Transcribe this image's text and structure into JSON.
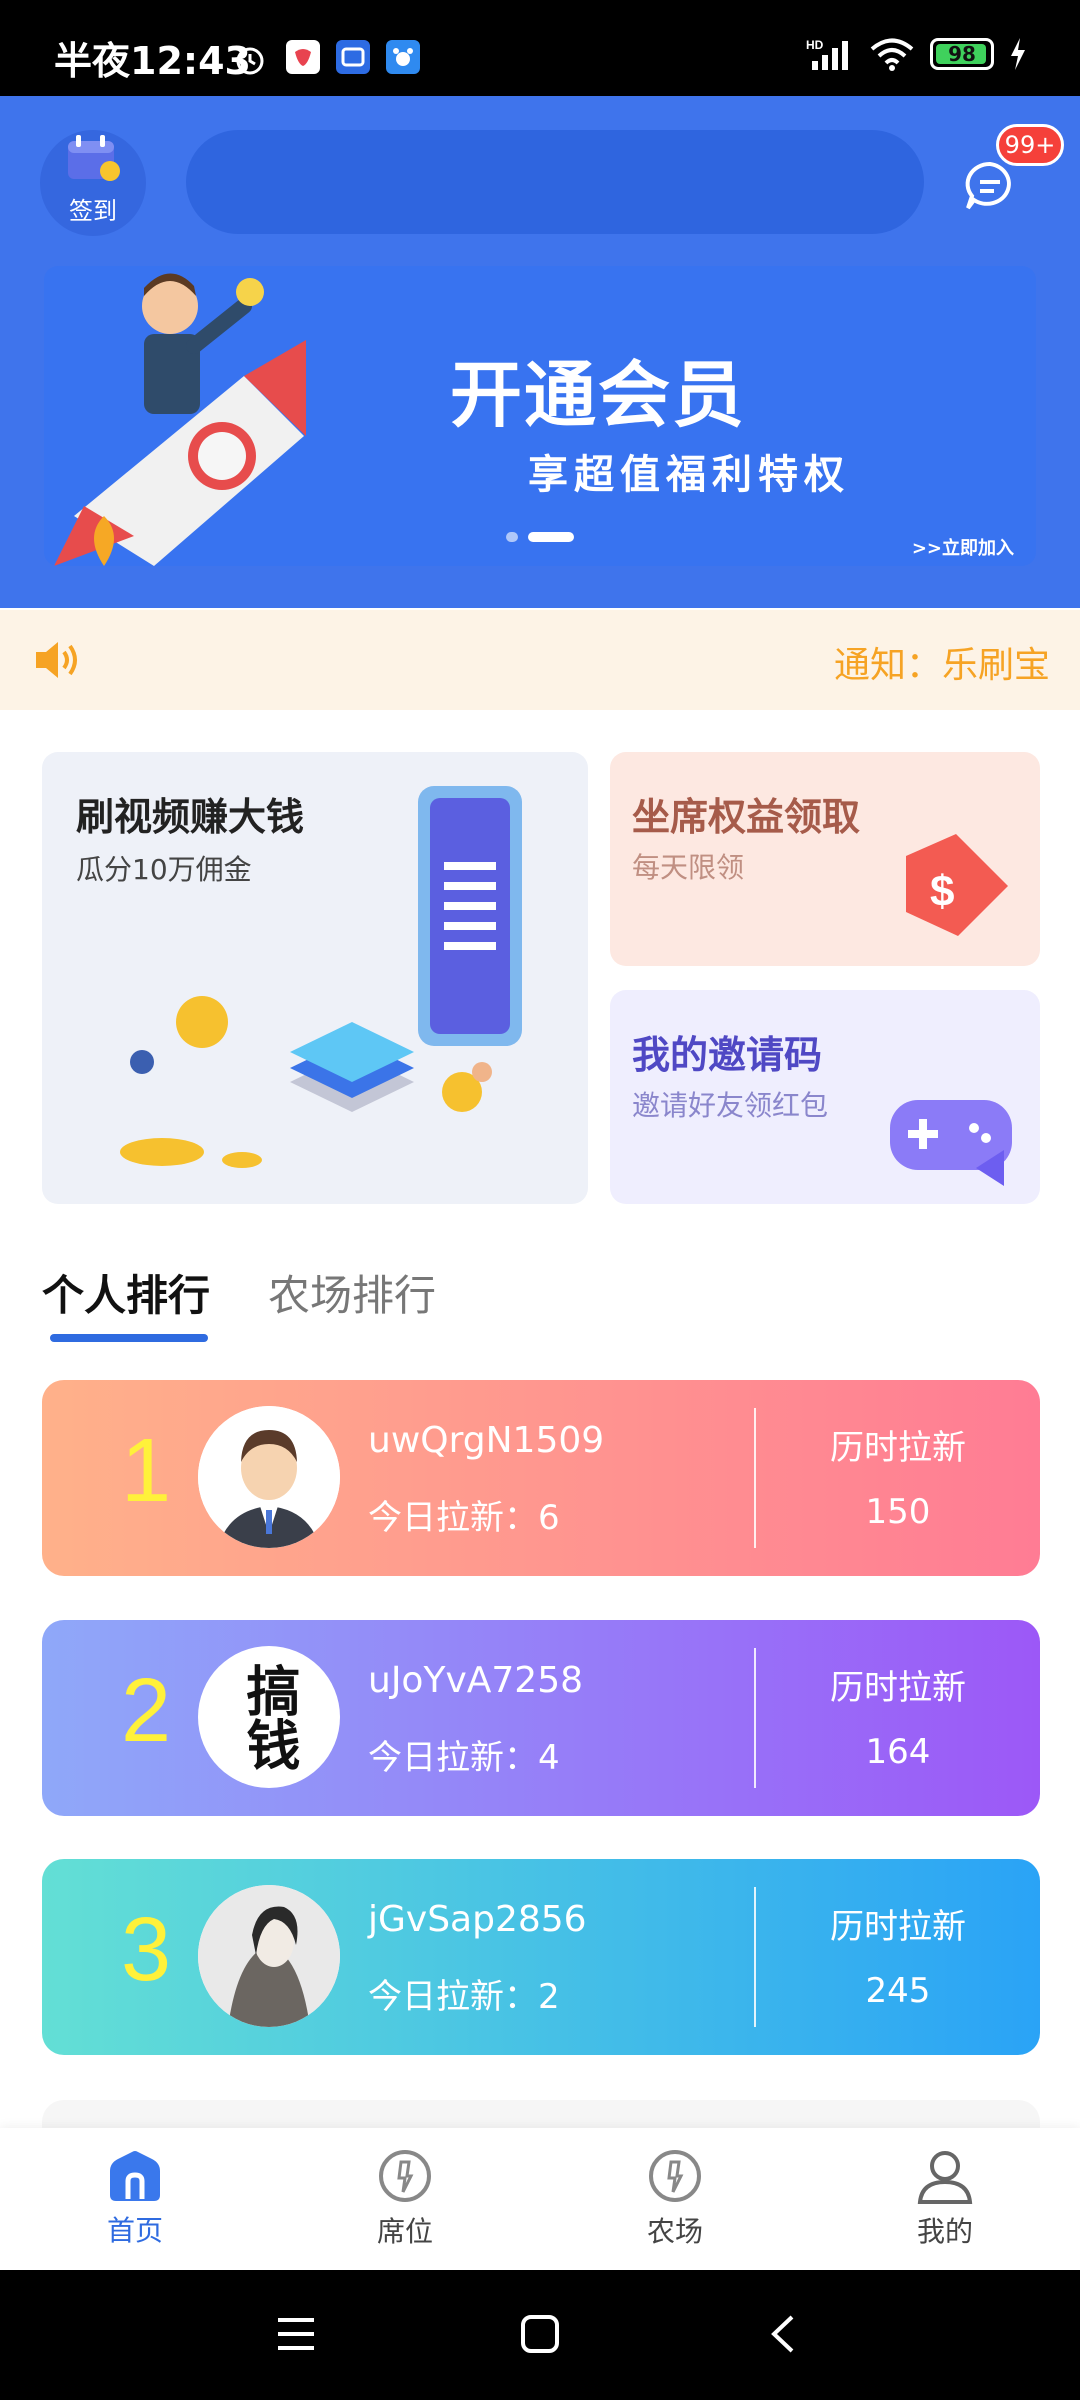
{
  "status_bar": {
    "time": "半夜12:43",
    "battery": "98",
    "signal_label": "HD"
  },
  "header": {
    "signin_label": "签到",
    "message_badge": "99+"
  },
  "banner": {
    "title": "开通会员",
    "subtitle": "享超值福利特权",
    "join_text": ">>立即加入"
  },
  "notice": {
    "text": "通知：乐刷宝"
  },
  "cards": {
    "video": {
      "title": "刷视频赚大钱",
      "subtitle": "瓜分10万佣金"
    },
    "seat": {
      "title": "坐席权益领取",
      "subtitle": "每天限领"
    },
    "invite": {
      "title": "我的邀请码",
      "subtitle": "邀请好友领红包"
    }
  },
  "tabs": [
    {
      "label": "个人排行",
      "active": true
    },
    {
      "label": "农场排行",
      "active": false
    }
  ],
  "ranking": [
    {
      "rank": "1",
      "username": "uwQrgN1509",
      "today": "今日拉新：6",
      "history_label": "历时拉新",
      "history_value": "150",
      "colors": [
        "#ffb18a",
        "#ff7c94"
      ]
    },
    {
      "rank": "2",
      "username": "uJoYvA7258",
      "today": "今日拉新：4",
      "history_label": "历时拉新",
      "history_value": "164",
      "colors": [
        "#8fa8f9",
        "#9c58f7"
      ]
    },
    {
      "rank": "3",
      "username": "jGvSap2856",
      "today": "今日拉新：2",
      "history_label": "历时拉新",
      "history_value": "245",
      "colors": [
        "#63dfd5",
        "#2aa3f6"
      ]
    }
  ],
  "avatar2_text": "搞钱",
  "bottom_nav": [
    {
      "label": "首页",
      "icon": "home-icon",
      "active": true
    },
    {
      "label": "席位",
      "icon": "seat-icon",
      "active": false
    },
    {
      "label": "农场",
      "icon": "farm-icon",
      "active": false
    },
    {
      "label": "我的",
      "icon": "profile-icon",
      "active": false
    }
  ],
  "colors": {
    "primary": "#3f74ec",
    "nav_active": "#2f6be0",
    "notice_text": "#f6a324",
    "rank_number": "#fff13a"
  }
}
